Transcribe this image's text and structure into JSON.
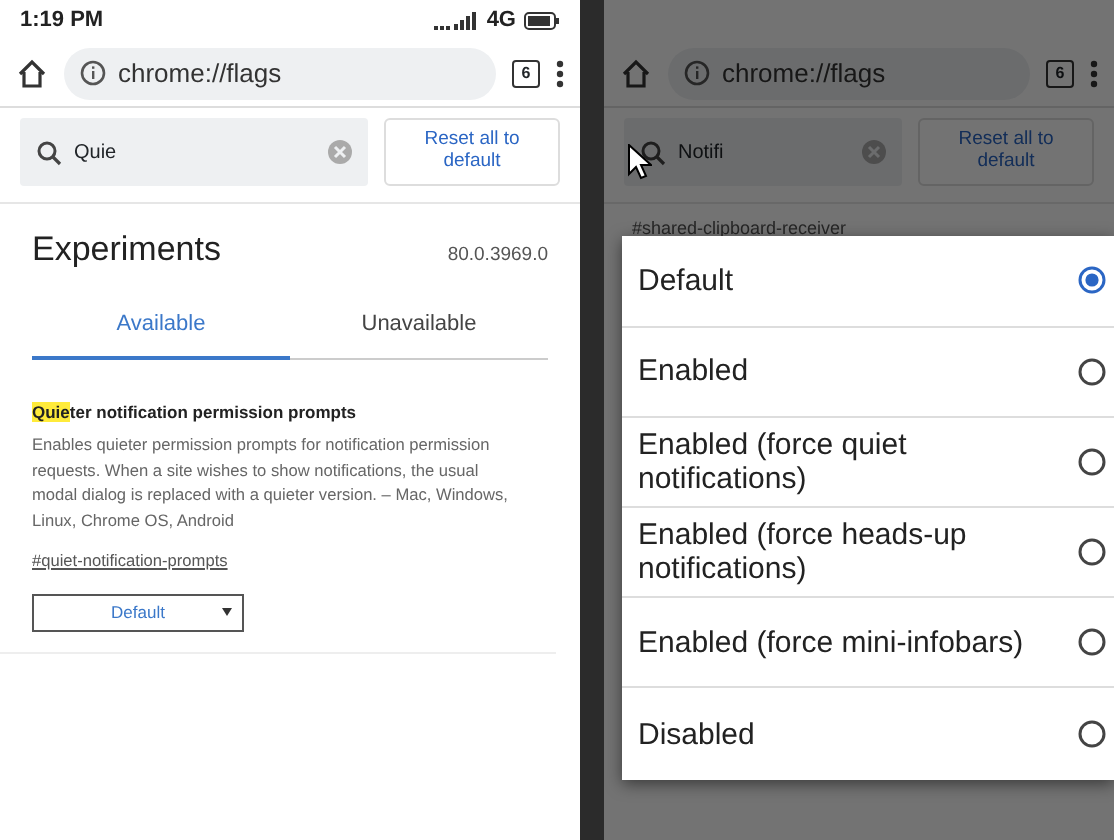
{
  "left_screen": {
    "status_bar": {
      "time": "1:19 PM",
      "network": "4G"
    },
    "toolbar": {
      "url": "chrome://flags",
      "tab_count": "6"
    },
    "search": {
      "value": "Quie"
    },
    "reset_button": "Reset all to default",
    "heading": "Experiments",
    "version": "80.0.3969.0",
    "tabs": [
      {
        "label": "Available",
        "selected": true
      },
      {
        "label": "Unavailable",
        "selected": false
      }
    ],
    "flag": {
      "title_match": "Quie",
      "title_rest": "ter notification permission prompts",
      "description": "Enables quieter permission prompts for notification permission requests. When a site wishes to show notifications, the usual modal dialog is replaced with a quieter version. – Mac, Windows, Linux, Chrome OS, Android",
      "link": "#quiet-notification-prompts",
      "dropdown": "Default"
    }
  },
  "right_screen": {
    "toolbar": {
      "url": "chrome://flags",
      "tab_count": "6"
    },
    "search": {
      "value": "Notifi"
    },
    "reset_button": "Reset all to default",
    "link": "#shared-clipboard-receiver",
    "dialog_options": [
      {
        "label": "Default",
        "selected": true
      },
      {
        "label": "Enabled",
        "selected": false
      },
      {
        "label": "Enabled (force quiet notifications)",
        "selected": false
      },
      {
        "label": "Enabled (force heads-up notifications)",
        "selected": false
      },
      {
        "label": "Enabled (force mini-infobars)",
        "selected": false
      },
      {
        "label": "Disabled",
        "selected": false
      }
    ]
  }
}
